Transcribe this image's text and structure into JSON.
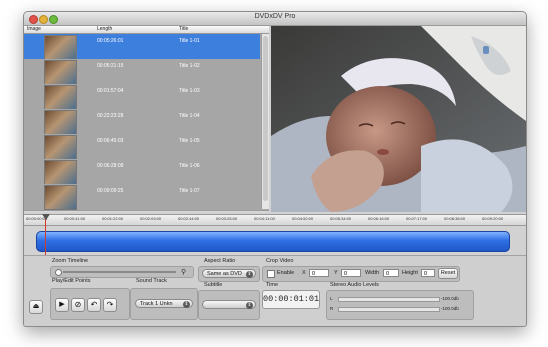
{
  "window": {
    "title": "DVDxDV Pro"
  },
  "list": {
    "columns": [
      "Image",
      "Length",
      "Title"
    ],
    "rows": [
      {
        "length": "00:05:26:01",
        "title": "Title 1-01",
        "selected": true
      },
      {
        "length": "00:05:21:15",
        "title": "Title 1-02"
      },
      {
        "length": "00:01:57:04",
        "title": "Title 1-03"
      },
      {
        "length": "00:22:23:28",
        "title": "Title 1-04"
      },
      {
        "length": "00:06:45:03",
        "title": "Title 1-05"
      },
      {
        "length": "00:06:28:09",
        "title": "Title 1-06"
      },
      {
        "length": "00:09:09:25",
        "title": "Title 1-07"
      }
    ]
  },
  "ruler": {
    "ticks": [
      "00:00:00:00",
      "00:00:41:00",
      "00:01:22:00",
      "00:02:03:00",
      "00:02:44:00",
      "00:03:25:00",
      "00:04:11:00",
      "00:04:52:00",
      "00:05:34:00",
      "00:06:16:00",
      "00:07:17:00",
      "00:08:38:00",
      "00:09:20:00"
    ]
  },
  "zoom": {
    "label": "Zoom Timeline"
  },
  "play": {
    "label": "Play/Edit Points"
  },
  "sound": {
    "label": "Sound Track",
    "value": "Track 1 Unkn"
  },
  "aspect": {
    "label": "Aspect Ratio",
    "value": "Same as DVD"
  },
  "subtitle": {
    "label": "Subtitle",
    "value": ""
  },
  "crop": {
    "label": "Crop Video",
    "enable": "Enable",
    "x_label": "X",
    "x": "0",
    "y_label": "Y",
    "y": "0",
    "width_label": "Width",
    "width": "0",
    "height_label": "Height",
    "height": "0",
    "reset": "Reset"
  },
  "time": {
    "label": "Time",
    "value": "00:00:01:01"
  },
  "audio": {
    "label": "Stereo Audio Levels",
    "l": "L",
    "r": "R",
    "l_db": "-100.0db",
    "r_db": "-100.0db"
  },
  "colors": {
    "selection": "#3d7fdd",
    "timeline": "#2f6fe4",
    "playhead": "#d43a2a"
  },
  "icons": [
    "eject-icon",
    "play-icon",
    "stop-icon",
    "set-in-point-icon",
    "set-out-point-icon",
    "magnifier-icon"
  ]
}
